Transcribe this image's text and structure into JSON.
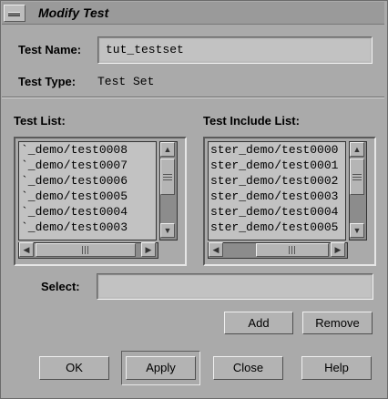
{
  "window": {
    "title": "Modify Test"
  },
  "test_name": {
    "label": "Test Name:",
    "value": "tut_testset"
  },
  "test_type": {
    "label": "Test Type:",
    "value": "Test Set"
  },
  "test_list": {
    "label": "Test List:",
    "items": [
      "`_demo/test0008",
      "`_demo/test0007",
      "`_demo/test0006",
      "`_demo/test0005",
      "`_demo/test0004",
      "`_demo/test0003"
    ]
  },
  "include_list": {
    "label": "Test Include List:",
    "items": [
      "ster_demo/test0000",
      "ster_demo/test0001",
      "ster_demo/test0002",
      "ster_demo/test0003",
      "ster_demo/test0004",
      "ster_demo/test0005"
    ]
  },
  "select": {
    "label": "Select:",
    "value": ""
  },
  "buttons": {
    "add": "Add",
    "remove": "Remove",
    "ok": "OK",
    "apply": "Apply",
    "close": "Close",
    "help": "Help"
  },
  "icons": {
    "up": "▲",
    "down": "▼",
    "left": "◀",
    "right": "▶"
  }
}
